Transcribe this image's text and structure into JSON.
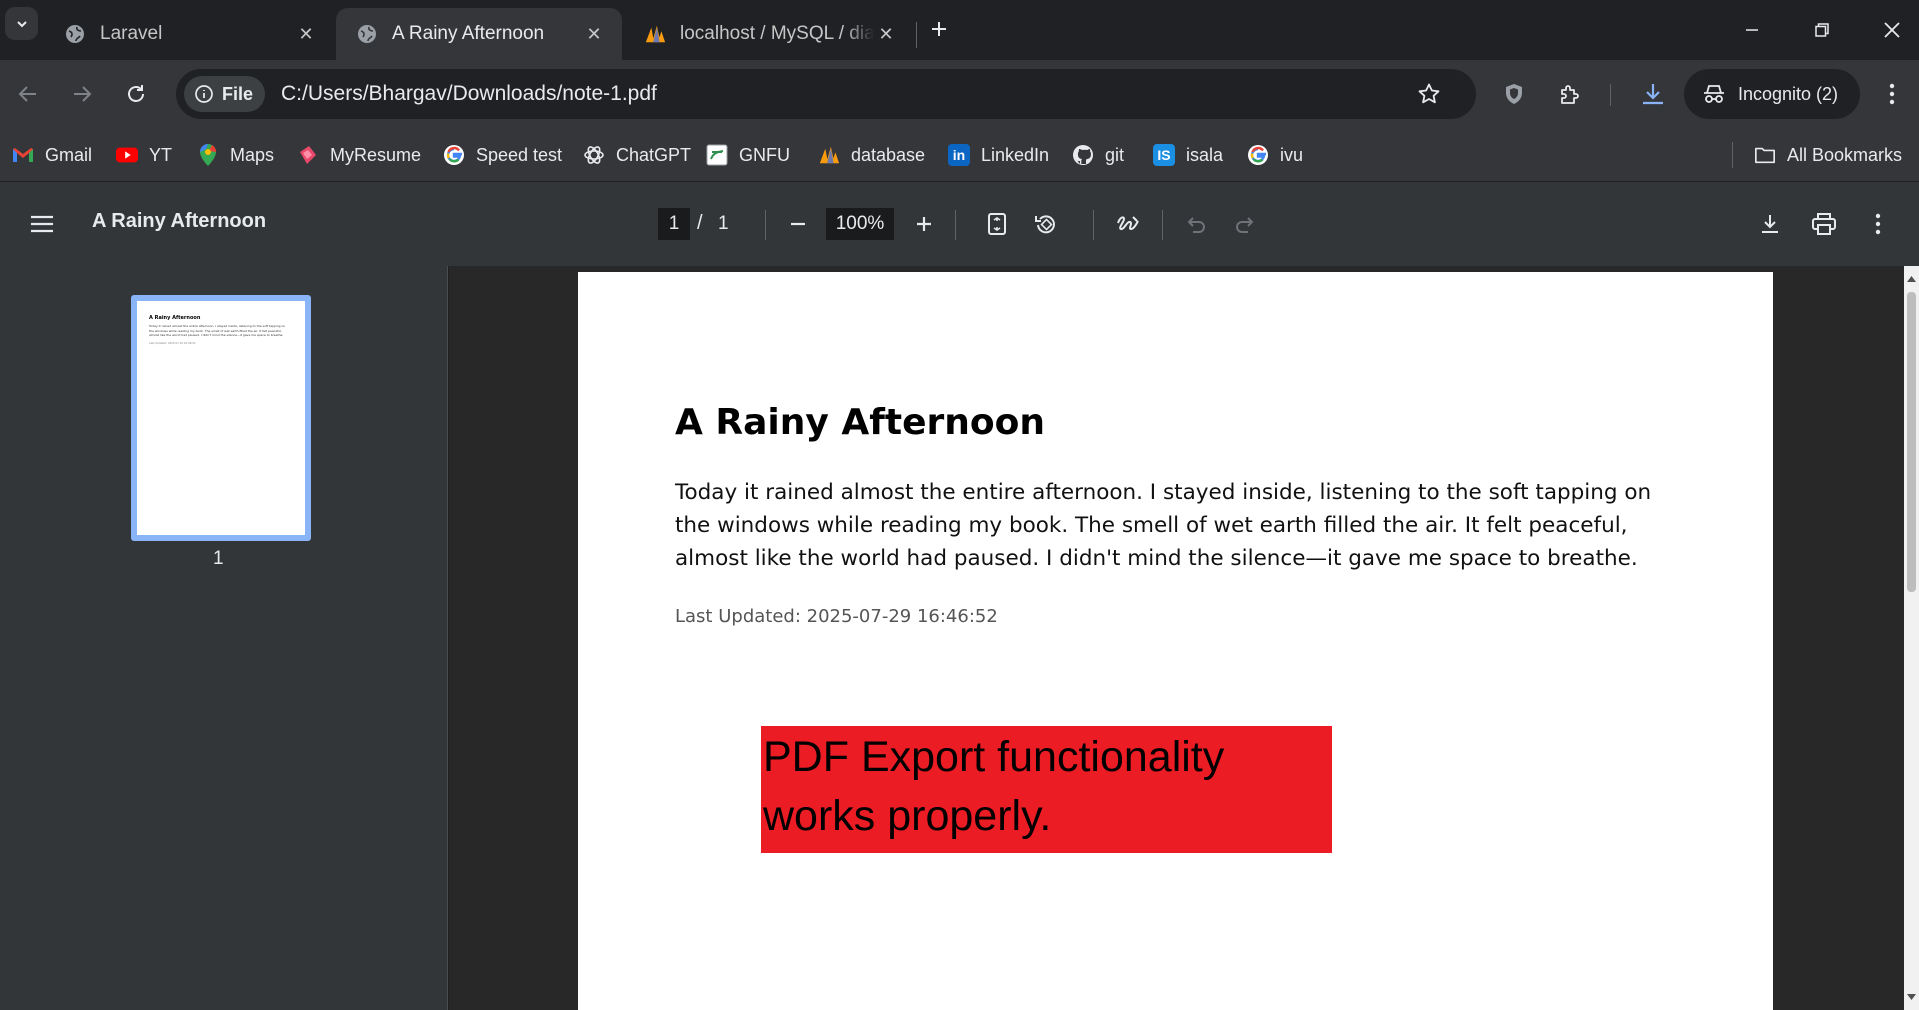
{
  "tabs": [
    {
      "title": "Laravel",
      "icon": "globe-icon"
    },
    {
      "title": "A Rainy Afternoon",
      "icon": "globe-icon"
    },
    {
      "title": "localhost / MySQL / diary / note",
      "icon": "phpmyadmin-icon"
    }
  ],
  "toolbar": {
    "chip_label": "File",
    "url": "C:/Users/Bhargav/Downloads/note-1.pdf",
    "incognito_label": "Incognito (2)"
  },
  "bookmarks": [
    {
      "label": "Gmail",
      "icon": "gmail-icon"
    },
    {
      "label": "YT",
      "icon": "youtube-icon"
    },
    {
      "label": "Maps",
      "icon": "maps-icon"
    },
    {
      "label": "MyResume",
      "icon": "resume-icon"
    },
    {
      "label": "Speed test",
      "icon": "google-icon"
    },
    {
      "label": "ChatGPT",
      "icon": "chatgpt-icon"
    },
    {
      "label": "GNFU",
      "icon": "gnfu-icon"
    },
    {
      "label": "database",
      "icon": "phpmyadmin-icon"
    },
    {
      "label": "LinkedIn",
      "icon": "linkedin-icon"
    },
    {
      "label": "git",
      "icon": "github-icon"
    },
    {
      "label": "isala",
      "icon": "is-icon"
    },
    {
      "label": "ivu",
      "icon": "google-icon"
    }
  ],
  "all_bookmarks_label": "All Bookmarks",
  "pdf_viewer": {
    "title": "A Rainy Afternoon",
    "current_page": "1",
    "page_separator": "/",
    "total_pages": "1",
    "zoom": "100%",
    "thumbnail_label": "1"
  },
  "document": {
    "heading": "A Rainy Afternoon",
    "body": "Today it rained almost the entire afternoon. I stayed inside, listening to the soft tapping on the windows while reading my book. The smell of wet earth filled the air. It felt peaceful, almost like the world had paused. I didn't mind the silence—it gave me space to breathe.",
    "last_updated": "Last Updated: 2025-07-29 16:46:52",
    "overlay_text": "PDF Export functionality works properly."
  },
  "colors": {
    "accent": "#8ab4f8",
    "overlay_red": "#ec1c24",
    "tab_strip": "#202124",
    "toolbar": "#35363a",
    "pdf_toolbar": "#323639"
  }
}
